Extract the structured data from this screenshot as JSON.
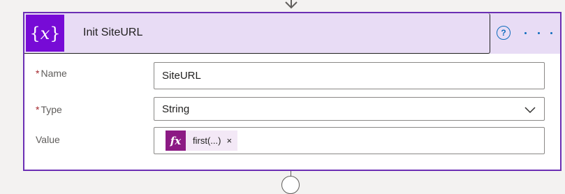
{
  "action": {
    "icon_text": "{x}",
    "title": "Init SiteURL",
    "help_icon": "help-circle-icon",
    "more_icon": "ellipsis-icon"
  },
  "fields": {
    "name": {
      "required_mark": "*",
      "label": "Name",
      "value": "SiteURL"
    },
    "type": {
      "required_mark": "*",
      "label": "Type",
      "value": "String"
    },
    "value": {
      "label": "Value",
      "token_icon": "fx",
      "token_label": "first(...)",
      "token_remove": "×"
    }
  },
  "colors": {
    "accent": "#6b2fb4",
    "icon_bg": "#770bd6",
    "header_bg": "#e8dcf5",
    "expression_bg": "#8c1a84"
  }
}
